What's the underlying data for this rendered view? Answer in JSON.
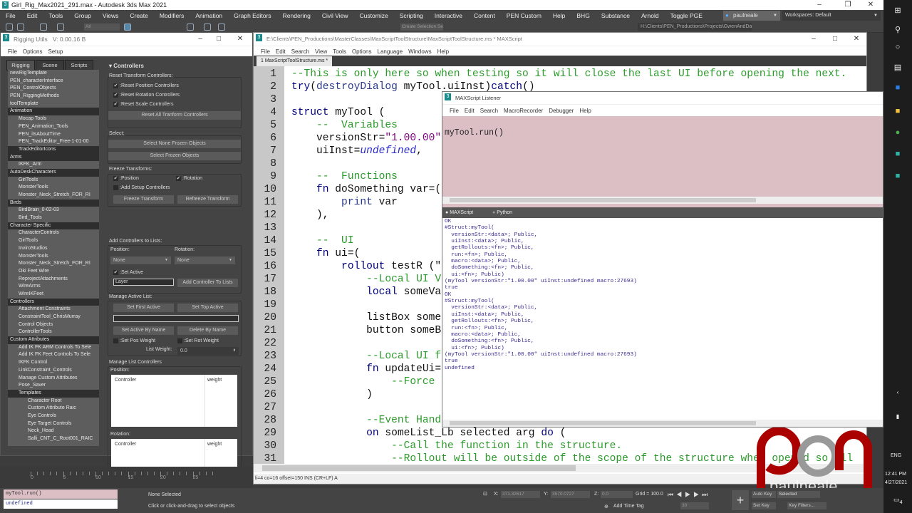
{
  "app": {
    "title": "Girl_Rig_Max2021_291.max - Autodesk 3ds Max 2021",
    "menu": [
      "File",
      "Edit",
      "Tools",
      "Group",
      "Views",
      "Create",
      "Modifiers",
      "Animation",
      "Graph Editors",
      "Rendering",
      "Civil View",
      "Customize",
      "Scripting",
      "Interactive",
      "Content",
      "PEN Custom",
      "Help",
      "BHG",
      "Substance",
      "Arnold",
      "Toggle PGE"
    ],
    "user": "paulneale",
    "workspaces_label": "Workspaces:",
    "workspace": "Default",
    "selection_filter": "All",
    "view_dropdown": "View",
    "selection_set": "Create Selection Se",
    "project_path": "H:\\Clients\\PEN_Productions\\Projects\\GwenAndDave"
  },
  "rigging_utils": {
    "title": "Rigging Utils",
    "version": "V: 0.00.16 B",
    "menu": [
      "File",
      "Options",
      "Setup"
    ],
    "tabs": [
      "Rigging",
      "Scene",
      "Scripts"
    ],
    "items": [
      {
        "label": "newRigTemplate",
        "level": 0
      },
      {
        "label": "PEN_characterInterface",
        "level": 0
      },
      {
        "label": "PEN_ControlObjects",
        "level": 0
      },
      {
        "label": "PEN_RiggingMethods",
        "level": 0
      },
      {
        "label": "toolTemplate",
        "level": 0
      },
      {
        "label": "Animation",
        "level": 0,
        "header": true
      },
      {
        "label": "Mocap Tools",
        "level": 1
      },
      {
        "label": "PEN_Animation_Tools",
        "level": 1
      },
      {
        "label": "PEN_itsAboutTime",
        "level": 1
      },
      {
        "label": "PEN_TrackEditor_Free-1-01-00",
        "level": 1
      },
      {
        "label": "TrackEditorIcons",
        "level": 1,
        "selected": true
      },
      {
        "label": "Arms",
        "level": 0,
        "header": true
      },
      {
        "label": "IKFK_Arm",
        "level": 1
      },
      {
        "label": "AutoDeskCharacters",
        "level": 0,
        "header": true
      },
      {
        "label": "GirlTools",
        "level": 1
      },
      {
        "label": "MonsterTools",
        "level": 1
      },
      {
        "label": "Monster_Neck_Stretch_FOR_RI",
        "level": 1
      },
      {
        "label": "Birds",
        "level": 0,
        "header": true
      },
      {
        "label": "BirdBrain_0-02-03",
        "level": 1
      },
      {
        "label": "Bird_Tools",
        "level": 1
      },
      {
        "label": "Character Specific",
        "level": 0,
        "header": true
      },
      {
        "label": "CharacterControls",
        "level": 1
      },
      {
        "label": "GirlTools",
        "level": 1
      },
      {
        "label": "InviroStudios",
        "level": 1
      },
      {
        "label": "MonsterTools",
        "level": 1
      },
      {
        "label": "Monster_Neck_Stretch_FOR_RI",
        "level": 1
      },
      {
        "label": "Oki Feet Wire",
        "level": 1
      },
      {
        "label": "ReprojectAttachments",
        "level": 1
      },
      {
        "label": "WireArms",
        "level": 1
      },
      {
        "label": "WireIKFeet",
        "level": 1
      },
      {
        "label": "Controllers",
        "level": 0,
        "header": true
      },
      {
        "label": "Attachment Constraints",
        "level": 1
      },
      {
        "label": "ConstraintTool_ChrisMurray",
        "level": 1
      },
      {
        "label": "Control Objects",
        "level": 1
      },
      {
        "label": "ControllerTools",
        "level": 1
      },
      {
        "label": "Custom Attributes",
        "level": 0,
        "header": true
      },
      {
        "label": "Add IK FK ARM Controls To Sele",
        "level": 1
      },
      {
        "label": "Add IK FK Feet Controls To Sele",
        "level": 1
      },
      {
        "label": "IKFK Control",
        "level": 1
      },
      {
        "label": "LinkConstraint_Controls",
        "level": 1
      },
      {
        "label": "Manage Custom Attributes",
        "level": 1
      },
      {
        "label": "Pose_Saver",
        "level": 1
      },
      {
        "label": "Templates",
        "level": 1,
        "header": true
      },
      {
        "label": "Character Root",
        "level": 2
      },
      {
        "label": "Custom Attribute Raic",
        "level": 2
      },
      {
        "label": "Eye Controls",
        "level": 2
      },
      {
        "label": "Eye Target Controls",
        "level": 2
      },
      {
        "label": "Neck_Head",
        "level": 2
      },
      {
        "label": "Salli_CNT_C_Root001_RAIC",
        "level": 2
      }
    ],
    "controllers": {
      "title": "Controllers",
      "reset_title": "Reset Transform Controllers:",
      "reset_pos": ":Reset Position Controllers",
      "reset_rot": ":Reset Rotation Controllers",
      "reset_scale": ":Reset Scale Controllers",
      "reset_all": "Reset All Tranform Controllers",
      "select_title": "Select:",
      "select_none_frozen": "Select None Frozen Objects",
      "select_frozen": "Select Frozen Objects",
      "freeze_title": "Freeze Transforms:",
      "freeze_pos": ":Position",
      "freeze_rot": ":Rotation",
      "add_setup": ":Add Setup Controllers",
      "freeze_btn": "Freeze Transform",
      "refreeze_btn": "Refreeze Transform",
      "add_title": "Add Controllers to Lists:",
      "position_label": "Position:",
      "rotation_label": "Rotation:",
      "position_value": "None",
      "rotation_value": "None",
      "set_active": ":Set Active",
      "layer_value": "Layer",
      "add_btn": "Add Controller To Lists",
      "active_title": "Manage Active List:",
      "set_first": "Set First Active",
      "set_top": "Set Top Active",
      "active_by_name": "Set Active By Name",
      "delete_by_name": "Delete By Name",
      "set_pos_weight": ":Set Pos Weight",
      "set_rot_weight": ":Set Rot Weight",
      "list_weight_label": "List Weight:",
      "list_weight": "0.0",
      "manage_title": "Manage List Controllers",
      "col_controller": "Controller",
      "col_weight": "weight"
    }
  },
  "editor": {
    "title": "E:\\Clients\\PEN_Productions\\MasterClasses\\MaxScriptToolStructure\\MaxScriptToolStructure.ms * MAXScript",
    "menu": [
      "File",
      "Edit",
      "Search",
      "View",
      "Tools",
      "Options",
      "Language",
      "Windows",
      "Help"
    ],
    "tab": "1 MaxScriptToolStructure.ms *",
    "lines": [
      [
        [
          "cm",
          "--This is only here so when testing so it will close the last UI before opening the next."
        ]
      ],
      [
        [
          "kw",
          "try"
        ],
        [
          "pl",
          "("
        ],
        [
          "fn",
          "destroyDialog"
        ],
        [
          "pl",
          " myTool.uiInst)"
        ],
        [
          "kw",
          "catch"
        ],
        [
          "pl",
          "()"
        ]
      ],
      [],
      [
        [
          "kw",
          "struct"
        ],
        [
          "pl",
          " myTool ("
        ]
      ],
      [
        [
          "cm",
          "    --  Variables"
        ]
      ],
      [
        [
          "pl",
          "    versionStr="
        ],
        [
          "st",
          "\"1.00.00\""
        ]
      ],
      [
        [
          "pl",
          "    uiInst="
        ],
        [
          "un",
          "undefined"
        ],
        [
          "pl",
          ","
        ]
      ],
      [],
      [
        [
          "cm",
          "    --  Functions"
        ]
      ],
      [
        [
          "kw",
          "    fn"
        ],
        [
          "pl",
          " doSomething var=("
        ]
      ],
      [
        [
          "fn",
          "        print"
        ],
        [
          "pl",
          " var"
        ]
      ],
      [
        [
          "pl",
          "    ),"
        ]
      ],
      [],
      [
        [
          "cm",
          "    --  UI"
        ]
      ],
      [
        [
          "kw",
          "    fn"
        ],
        [
          "pl",
          " ui=("
        ]
      ],
      [
        [
          "kw",
          "        rollout"
        ],
        [
          "pl",
          " testR (\""
        ]
      ],
      [
        [
          "cm",
          "            --Local UI Va"
        ]
      ],
      [
        [
          "kw",
          "            local"
        ],
        [
          "pl",
          " someVa"
        ]
      ],
      [],
      [
        [
          "pl",
          "            listBox some"
        ]
      ],
      [
        [
          "pl",
          "            button someBu"
        ]
      ],
      [],
      [
        [
          "cm",
          "            --Local UI fu"
        ]
      ],
      [
        [
          "kw",
          "            fn"
        ],
        [
          "pl",
          " updateUi="
        ]
      ],
      [
        [
          "cm",
          "                --Force"
        ]
      ],
      [
        [
          "pl",
          "            )"
        ]
      ],
      [],
      [
        [
          "cm",
          "            --Event Handl"
        ]
      ],
      [
        [
          "kw",
          "            on"
        ],
        [
          "pl",
          " someList_Lb selected arg "
        ],
        [
          "kw",
          "do"
        ],
        [
          "pl",
          " ("
        ]
      ],
      [
        [
          "cm",
          "                --Call the function in the structure."
        ]
      ],
      [
        [
          "cm",
          "                --Rollout will be outside of the scope of the structure when opened so all"
        ]
      ]
    ],
    "status": "li=4 co=16 offset=150 INS (CR+LF) A"
  },
  "listener": {
    "title": "MAXScript Listener",
    "menu": [
      "File",
      "Edit",
      "Search",
      "MacroRecorder",
      "Debugger",
      "Help"
    ],
    "input": "myTool.run()",
    "tabs": [
      "MAXScript",
      "Python"
    ],
    "output": [
      "OK",
      "#Struct:myTool(",
      "  versionStr:<data>; Public,",
      "  uiInst:<data>; Public,",
      "  getRollouts:<fn>; Public,",
      "  run:<fn>; Public,",
      "  macro:<data>; Public,",
      "  doSomething:<fn>; Public,",
      "  ui:<fn>; Public)",
      "(myTool versionStr:\"1.00.00\" uiInst:undefined macro:27693)",
      "true",
      "OK",
      "#Struct:myTool(",
      "  versionStr:<data>; Public,",
      "  uiInst:<data>; Public,",
      "  getRollouts:<fn>; Public,",
      "  run:<fn>; Public,",
      "  macro:<data>; Public,",
      "  doSomething:<fn>; Public,",
      "  ui:<fn>; Public)",
      "(myTool versionStr:\"1.00.00\" uiInst:undefined macro:27693)",
      "true",
      "undefined"
    ]
  },
  "timeline": {
    "ticks": [
      "0",
      "5",
      "10",
      "15",
      "20",
      "25"
    ]
  },
  "statusbar": {
    "mini_input": "myTool.run()",
    "mini_output": "undefined",
    "selection": "None Selected",
    "prompt": "Click or click-and-drag to select objects",
    "x_label": "X:",
    "x": "371.32617",
    "y_label": "Y:",
    "y": "3570.0727",
    "z_label": "Z:",
    "z": "0.0",
    "grid": "Grid = 100.0",
    "add_time_tag": "Add Time Tag",
    "frame": "30",
    "auto_key": "Auto Key",
    "key_mode": "Selected",
    "set_key": "Set Key",
    "key_filters": "Key Filters..."
  },
  "watermark": "paulneale",
  "taskbar": {
    "lang": "ENG",
    "time": "12:41 PM",
    "date": "4/27/2021",
    "notifications": "4"
  }
}
